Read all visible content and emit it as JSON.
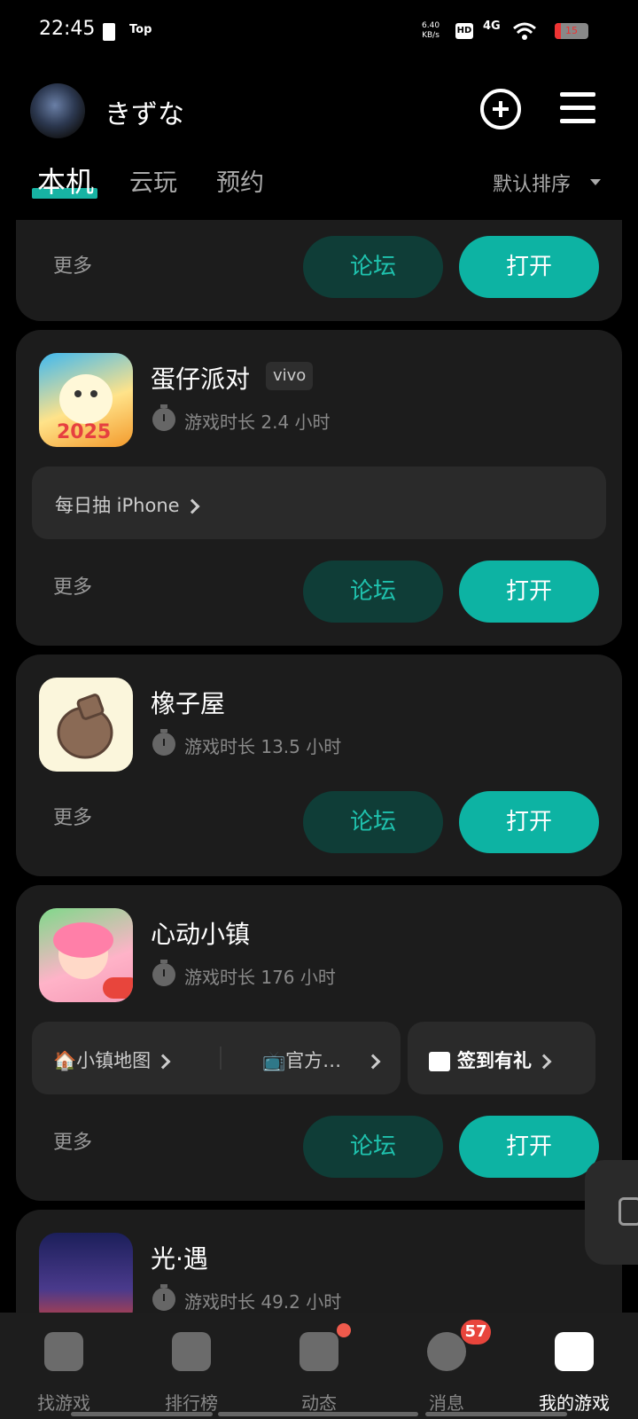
{
  "status_bar": {
    "time": "22:45",
    "tag": "Top",
    "speed_top": "6.40",
    "speed_bottom": "KB/s",
    "hd": "HD",
    "network": "4G",
    "battery": "15"
  },
  "header": {
    "username": "きずな"
  },
  "tabs": [
    {
      "label": "本机"
    },
    {
      "label": "云玩"
    },
    {
      "label": "预约"
    }
  ],
  "sort": {
    "label": "默认排序"
  },
  "actions": {
    "more": "更多",
    "forum": "论坛",
    "open": "打开"
  },
  "games": [
    {
      "name": "蛋仔派对",
      "tag": "vivo",
      "playtime": "游戏时长 2.4 小时",
      "promo": "每日抽 iPhone"
    },
    {
      "name": "橡子屋",
      "playtime": "游戏时长 13.5 小时"
    },
    {
      "name": "心动小镇",
      "playtime": "游戏时长 176 小时",
      "links": [
        "🏠小镇地图",
        "📺官方…",
        "签到有礼"
      ]
    },
    {
      "name": "光·遇",
      "playtime": "游戏时长 49.2 小时"
    }
  ],
  "bottom_nav": [
    {
      "label": "找游戏"
    },
    {
      "label": "排行榜"
    },
    {
      "label": "动态"
    },
    {
      "label": "消息",
      "badge": "57"
    },
    {
      "label": "我的游戏"
    }
  ],
  "colors": {
    "accent": "#0db3a3",
    "forum_bg": "#0f3d37",
    "card_bg": "#1c1c1c",
    "badge": "#e8453c"
  }
}
